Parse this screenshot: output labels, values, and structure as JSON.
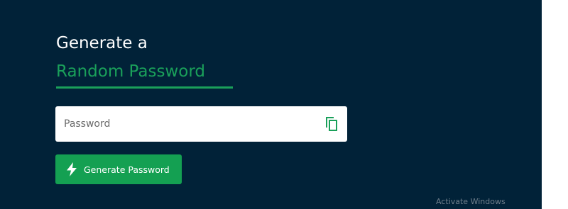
{
  "heading": {
    "line1": "Generate a",
    "line2": "Random Password"
  },
  "password_field": {
    "value": "",
    "placeholder": "Password"
  },
  "copy_button": {
    "icon": "copy-icon"
  },
  "generate_button": {
    "icon": "lightning-bolt-icon",
    "label": "Generate Password"
  },
  "watermark": {
    "text": "Activate Windows"
  },
  "colors": {
    "background": "#012238",
    "accent": "#1aa05a",
    "button": "#14a052",
    "heading": "#ffffff"
  }
}
